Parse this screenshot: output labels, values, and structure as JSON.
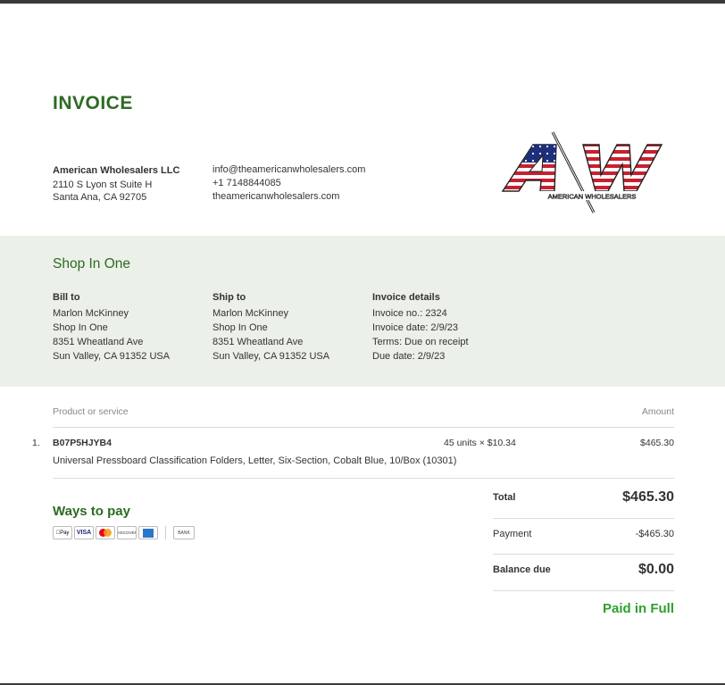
{
  "invoice": {
    "title": "INVOICE",
    "company": {
      "name": "American Wholesalers LLC",
      "address_line1": "2110 S Lyon st Suite H",
      "address_line2": "Santa Ana, CA 92705",
      "email": "info@theamericanwholesalers.com",
      "phone": "+1 7148844085",
      "website": "theamericanwholesalers.com",
      "logo_text": "AW",
      "logo_tagline": "AMERICAN WHOLESALERS"
    },
    "customer_name": "Shop In One",
    "bill_to": {
      "heading": "Bill to",
      "lines": [
        "Marlon McKinney",
        "Shop In One",
        "8351 Wheatland Ave",
        "Sun Valley, CA 91352 USA"
      ]
    },
    "ship_to": {
      "heading": "Ship to",
      "lines": [
        "Marlon McKinney",
        "Shop In One",
        "8351 Wheatland Ave",
        "Sun Valley, CA 91352 USA"
      ]
    },
    "details": {
      "heading": "Invoice details",
      "lines": [
        "Invoice no.: 2324",
        "Invoice date: 2/9/23",
        "Terms: Due on receipt",
        "Due date: 2/9/23"
      ]
    },
    "table": {
      "col_product": "Product or service",
      "col_amount": "Amount",
      "items": [
        {
          "index": "1.",
          "sku": "B07P5HJYB4",
          "description": "Universal Pressboard Classification Folders, Letter, Six-Section, Cobalt Blue, 10/Box (10301)",
          "qty": "45 units × $10.34",
          "amount": "$465.30"
        }
      ]
    },
    "ways_to_pay": {
      "heading": "Ways to pay",
      "methods": [
        "Pay",
        "VISA",
        "DISCOVER",
        "BANK"
      ]
    },
    "totals": {
      "total_label": "Total",
      "total_value": "$465.30",
      "payment_label": "Payment",
      "payment_value": "-$465.30",
      "balance_label": "Balance due",
      "balance_value": "$0.00"
    },
    "status": "Paid in Full",
    "colors": {
      "brand_green": "#2c6b22",
      "band_bg": "#ebf0e8",
      "paid_green": "#2ea02e"
    }
  }
}
